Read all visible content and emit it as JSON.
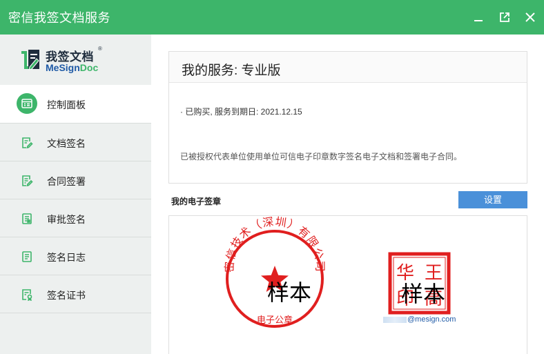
{
  "window": {
    "title": "密信我签文档服务",
    "buttons": [
      "minimize-icon",
      "restore-icon",
      "close-icon"
    ]
  },
  "brand": {
    "name_cn": "我签文档",
    "name_en_main": "MeSign",
    "name_en_accent": "Doc",
    "registered_mark": "®"
  },
  "sidebar": {
    "items": [
      {
        "label": "控制面板",
        "icon": "dashboard-icon",
        "active": true
      },
      {
        "label": "文档签名",
        "icon": "document-sign-icon",
        "active": false
      },
      {
        "label": "合同签署",
        "icon": "contract-sign-icon",
        "active": false
      },
      {
        "label": "审批签名",
        "icon": "approval-sign-icon",
        "active": false
      },
      {
        "label": "签名日志",
        "icon": "sign-log-icon",
        "active": false
      },
      {
        "label": "签名证书",
        "icon": "certificate-icon",
        "active": false
      }
    ]
  },
  "service": {
    "title": "我的服务: 专业版",
    "purchase_status": "· 已购买, 服务到期日: 2021.12.15",
    "description": "已被授权代表单位使用单位可信电子印章数字签名电子文档和签署电子合同。"
  },
  "seals": {
    "section_title": "我的电子签章",
    "settings_label": "设置",
    "company_seal": {
      "arc_text": "密信技术（深圳）有限公司",
      "bottom_text": "电子公章",
      "watermark": "样本"
    },
    "personal_seal": {
      "chars": [
        "华",
        "王",
        "印",
        "高"
      ],
      "watermark": "样本",
      "email": "@mesign.com"
    }
  },
  "colors": {
    "titlebar": "#3db56a",
    "sidebar": "#edf0ef",
    "accent_blue": "#4a90d9",
    "seal_red": "#e01f1f"
  }
}
